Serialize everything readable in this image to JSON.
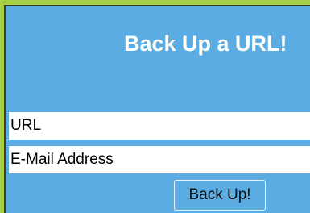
{
  "form": {
    "title": "Back Up a URL!",
    "url_placeholder": "URL",
    "email_placeholder": "E-Mail Address",
    "submit_label": "Back Up!"
  },
  "colors": {
    "page_background": "#a6d048",
    "panel_background": "#5aace2",
    "title_text": "#ffffff"
  }
}
